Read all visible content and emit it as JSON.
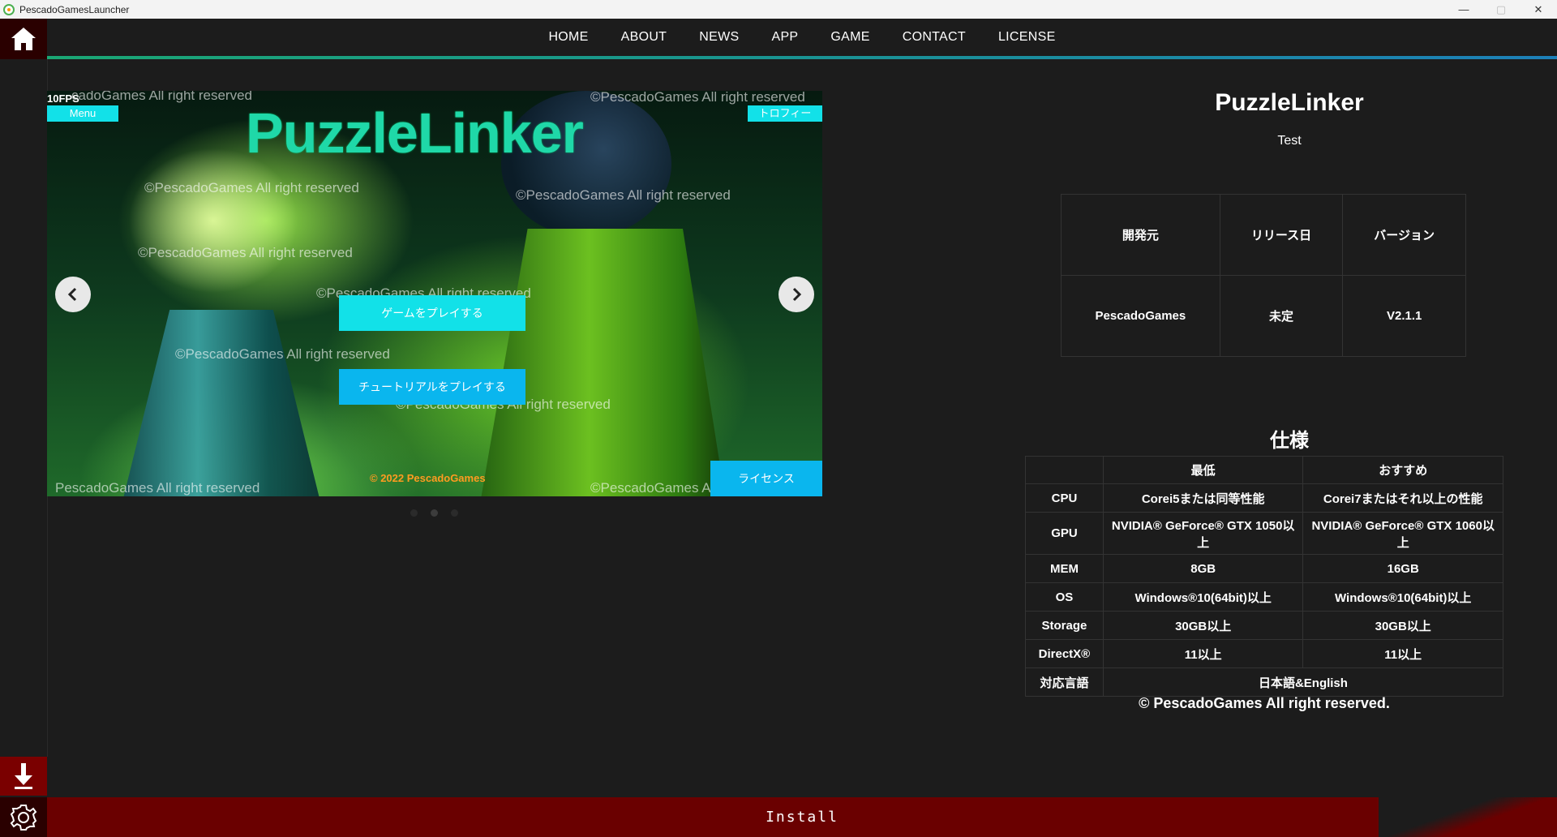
{
  "window": {
    "title": "PescadoGamesLauncher",
    "controls": {
      "minimize": "—",
      "maximize": "▢",
      "close": "✕"
    }
  },
  "nav": {
    "items": [
      "HOME",
      "ABOUT",
      "NEWS",
      "APP",
      "GAME",
      "CONTACT",
      "LICENSE"
    ]
  },
  "sidebar": {
    "home_icon": "home-icon",
    "download_icon": "download-arrow-icon",
    "settings_icon": "gear-icon"
  },
  "carousel": {
    "game_title": "PuzzleLinker",
    "fps": "10FPS",
    "menu_label": "Menu",
    "trophy_label": "トロフィー",
    "play_label": "ゲームをプレイする",
    "tutorial_label": "チュートリアルをプレイする",
    "license_label": "ライセンス",
    "copyright": "© 2022 PescadoGames",
    "watermark": "©PescadoGames All right reserved",
    "watermark_top_left": "cadoGames All right reserved",
    "watermark_bottom_left": "PescadoGames All right reserved",
    "slides": 3,
    "active_slide": 2
  },
  "info": {
    "title": "PuzzleLinker",
    "subtitle": "Test",
    "headers": [
      "開発元",
      "リリース日",
      "バージョン"
    ],
    "values": [
      "PescadoGames",
      "未定",
      "V2.1.1"
    ]
  },
  "spec": {
    "title": "仕様",
    "columns": [
      "",
      "最低",
      "おすすめ"
    ],
    "rows": [
      {
        "label": "CPU",
        "min": "Corei5または同等性能",
        "rec": "Corei7またはそれ以上の性能"
      },
      {
        "label": "GPU",
        "min": "NVIDIA® GeForce® GTX 1050以上",
        "rec": "NVIDIA® GeForce® GTX 1060以上"
      },
      {
        "label": "MEM",
        "min": "8GB",
        "rec": "16GB"
      },
      {
        "label": "OS",
        "min": "Windows®10(64bit)以上",
        "rec": "Windows®10(64bit)以上"
      },
      {
        "label": "Storage",
        "min": "30GB以上",
        "rec": "30GB以上"
      },
      {
        "label": "DirectX®",
        "min": "11以上",
        "rec": "11以上"
      }
    ],
    "language_label": "対応言語",
    "language_value": "日本語&English",
    "footer": "© PescadoGames All right reserved."
  },
  "install": {
    "label": "Install"
  }
}
